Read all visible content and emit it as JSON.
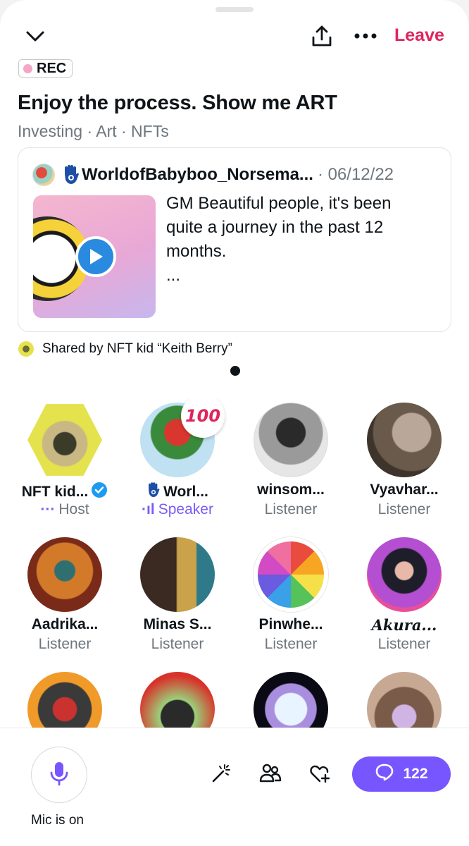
{
  "header": {
    "leave_label": "Leave",
    "icons": [
      "chevron-down-icon",
      "share-icon",
      "more-icon"
    ]
  },
  "recording": {
    "label": "REC",
    "dot_color": "#f4a6c6"
  },
  "space": {
    "title": "Enjoy the process. Show me ART",
    "topics": "Investing · Art · NFTs"
  },
  "pinned_tweet": {
    "author": "WorldofBabyboo_Norsema...",
    "date": "· 06/12/22",
    "text_line1": "GM Beautiful people, it's been",
    "text_line2": "quite a journey in the past 12",
    "text_line3": "months.",
    "text_more": "..."
  },
  "shared_by": "Shared by NFT kid “Keith Berry”",
  "participants": [
    {
      "name": "NFT kid...",
      "role": "Host",
      "indicator": "···",
      "verified": true
    },
    {
      "name": "Worl...",
      "role": "Speaker",
      "indicator": "·ıl",
      "badge": "100"
    },
    {
      "name": "winsom...",
      "role": "Listener"
    },
    {
      "name": "Vyavhar...",
      "role": "Listener"
    },
    {
      "name": "Aadrika...",
      "role": "Listener"
    },
    {
      "name": "Minas S...",
      "role": "Listener"
    },
    {
      "name": "Pinwhe...",
      "role": "Listener"
    },
    {
      "name": "Akura...",
      "role": "Listener"
    },
    {
      "name": "",
      "role": ""
    },
    {
      "name": "",
      "role": ""
    },
    {
      "name": "",
      "role": ""
    },
    {
      "name": "",
      "role": ""
    }
  ],
  "footer": {
    "mic_label": "Mic is on",
    "comment_count": "122",
    "accent": "#7856ff"
  }
}
